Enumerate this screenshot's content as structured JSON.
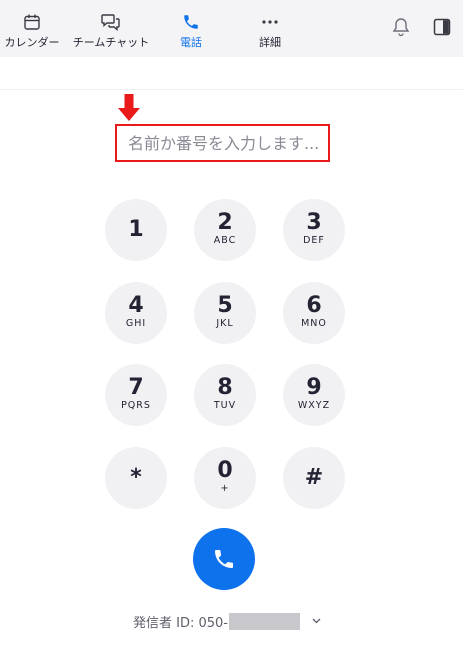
{
  "nav": {
    "calendar_label": "カレンダー",
    "chat_label": "チームチャット",
    "phone_label": "電話",
    "more_label": "詳細",
    "active_color": "#0e72ed"
  },
  "search": {
    "placeholder": "名前か番号を入力します...",
    "value": ""
  },
  "dialpad": {
    "keys": [
      {
        "digit": "1",
        "letters": ""
      },
      {
        "digit": "2",
        "letters": "ABC"
      },
      {
        "digit": "3",
        "letters": "DEF"
      },
      {
        "digit": "4",
        "letters": "GHI"
      },
      {
        "digit": "5",
        "letters": "JKL"
      },
      {
        "digit": "6",
        "letters": "MNO"
      },
      {
        "digit": "7",
        "letters": "PQRS"
      },
      {
        "digit": "8",
        "letters": "TUV"
      },
      {
        "digit": "9",
        "letters": "WXYZ"
      },
      {
        "digit": "*",
        "letters": ""
      },
      {
        "digit": "0",
        "letters": "+"
      },
      {
        "digit": "#",
        "letters": ""
      }
    ]
  },
  "caller_id": {
    "label": "発信者 ID: 050-"
  },
  "colors": {
    "call_button": "#0e72ed",
    "highlight_border": "#e81a1a",
    "arrow": "#e81a1a"
  }
}
